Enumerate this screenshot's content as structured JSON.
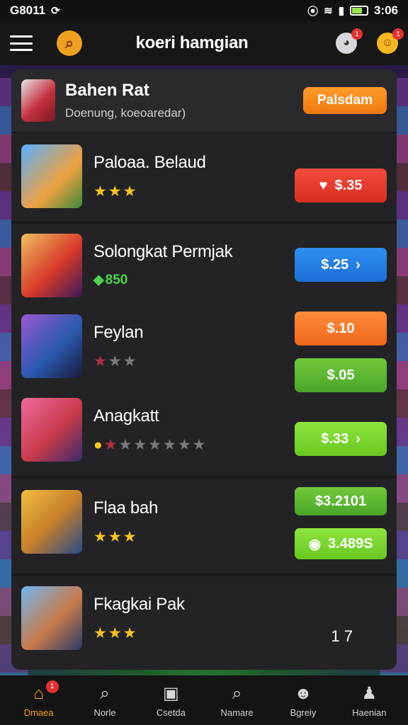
{
  "status_bar": {
    "left_text": "G8011",
    "time": "3:06"
  },
  "header": {
    "title": "koeri hamgian",
    "notif_left": "1",
    "notif_right": "1"
  },
  "featured": {
    "name": "Bahen Rat",
    "subtitle": "Doenung, koeoaredar)",
    "button_label": "Palsdam"
  },
  "games": [
    {
      "title": "Paloaa. Belaud",
      "rating": 3,
      "prices": [
        {
          "label": "$.35",
          "color": "#e8402e",
          "icon": "heart",
          "arrow": false
        }
      ]
    },
    {
      "title": "Solongkat Permjak",
      "stock": "850",
      "prices": [
        {
          "label": "$.25",
          "color": "#2484e8",
          "icon": "",
          "arrow": true
        }
      ]
    },
    {
      "title": "Feylan",
      "rating": 1,
      "prices": [
        {
          "label": "$.10",
          "color": "#f57a2a",
          "icon": "",
          "arrow": false
        },
        {
          "label": "$.05",
          "color": "#5db432",
          "icon": "",
          "arrow": false
        }
      ]
    },
    {
      "title": "Anagkatt",
      "rating": 2,
      "prices": [
        {
          "label": "$.33",
          "color": "#7dd632",
          "icon": "",
          "arrow": true
        }
      ]
    },
    {
      "title": "Flaa bah",
      "rating": 3,
      "prices": [
        {
          "label": "$3.2101",
          "color": "#5db432",
          "icon": "",
          "arrow": false
        },
        {
          "label": "3.489S",
          "color": "#7dd632",
          "icon": "coin",
          "arrow": false
        }
      ]
    },
    {
      "title": "Fkagkai Pak",
      "rating": 3,
      "quantity": "1 7"
    }
  ],
  "bottom_nav": [
    {
      "label": "Dmaea",
      "icon": "home",
      "badge": "1"
    },
    {
      "label": "Norle",
      "icon": "search",
      "badge": ""
    },
    {
      "label": "Csetda",
      "icon": "store",
      "badge": ""
    },
    {
      "label": "Namare",
      "icon": "search",
      "badge": ""
    },
    {
      "label": "Bgreiy",
      "icon": "ghost",
      "badge": ""
    },
    {
      "label": "Haenian",
      "icon": "profile",
      "badge": ""
    }
  ]
}
